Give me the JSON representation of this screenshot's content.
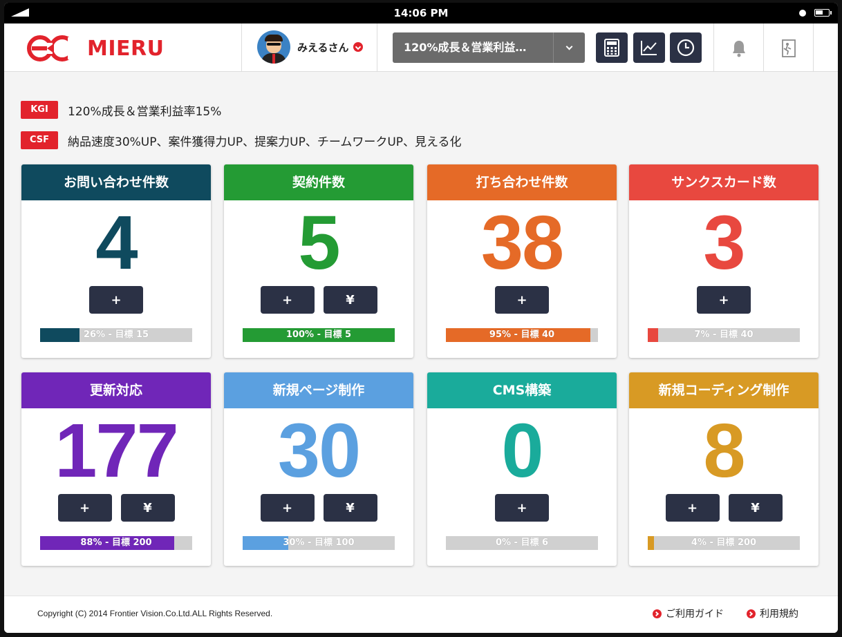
{
  "status_bar": {
    "time": "14:06 PM"
  },
  "header": {
    "logo_text": "MIERU",
    "user_name": "みえるさん",
    "goal_select": "120%成長＆営業利益…"
  },
  "meta": {
    "kgi": {
      "tag": "KGI",
      "text": "120%成長＆営業利益率15%"
    },
    "csf": {
      "tag": "CSF",
      "text": "納品速度30%UP、案件獲得力UP、提案力UP、チームワークUP、見える化"
    }
  },
  "colors": {
    "brand": "#e2232c",
    "button": "#2b3145"
  },
  "cards": [
    {
      "title": "お問い合わせ件数",
      "value": "4",
      "color": "#0f4a5e",
      "buttons": [
        "+"
      ],
      "progress": 0.26,
      "bar_label": "26% - 目標 15"
    },
    {
      "title": "契約件数",
      "value": "5",
      "color": "#249b34",
      "buttons": [
        "+",
        "¥"
      ],
      "progress": 1.0,
      "bar_label": "100% - 目標 5"
    },
    {
      "title": "打ち合わせ件数",
      "value": "38",
      "color": "#e56a27",
      "buttons": [
        "+"
      ],
      "progress": 0.95,
      "bar_label": "95% - 目標 40"
    },
    {
      "title": "サンクスカード数",
      "value": "3",
      "color": "#e8483f",
      "buttons": [
        "+"
      ],
      "progress": 0.07,
      "bar_label": "7% - 目標 40"
    },
    {
      "title": "更新対応",
      "value": "177",
      "color": "#7026b8",
      "buttons": [
        "+",
        "¥"
      ],
      "progress": 0.88,
      "bar_label": "88% - 目標 200"
    },
    {
      "title": "新規ページ制作",
      "value": "30",
      "color": "#5ba0e0",
      "buttons": [
        "+",
        "¥"
      ],
      "progress": 0.3,
      "bar_label": "30% - 目標 100"
    },
    {
      "title": "CMS構築",
      "value": "0",
      "color": "#1aab9b",
      "buttons": [
        "+"
      ],
      "progress": 0.0,
      "bar_label": "0% - 目標 6"
    },
    {
      "title": "新規コーディング制作",
      "value": "8",
      "color": "#d89a24",
      "buttons": [
        "+",
        "¥"
      ],
      "progress": 0.04,
      "bar_label": "4% - 目標 200"
    }
  ],
  "footer": {
    "copyright": "Copyright (C) 2014 Frontier Vision.Co.Ltd.ALL Rights Reserved.",
    "guide": "ご利用ガイド",
    "terms": "利用規約"
  }
}
